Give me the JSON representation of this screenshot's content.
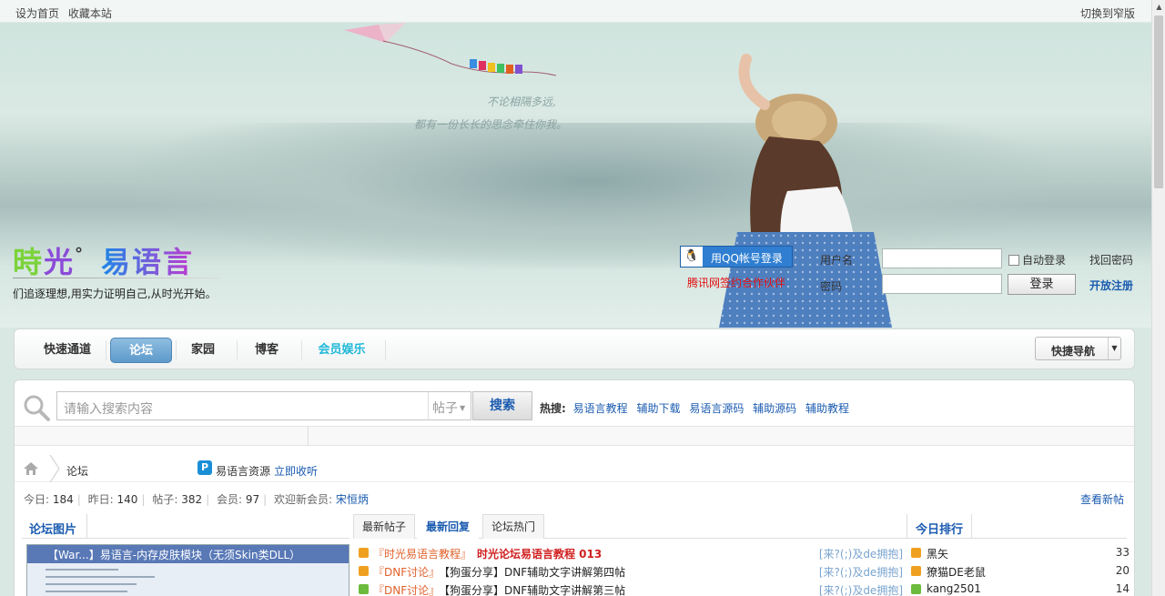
{
  "topbar": {
    "set_home": "设为首页",
    "bookmark": "收藏本站",
    "switch_width": "切换到窄版"
  },
  "header": {
    "logo_parts": [
      "時",
      "光",
      "°",
      "易语言"
    ],
    "slogan": "们追逐理想,用实力证明自己,从时光开始。",
    "poem_line1": "不论相隔多远,",
    "poem_line2": "都有一份长长的思念牵住你我。"
  },
  "login": {
    "qq_button": "用QQ帐号登录",
    "qq_partner": "腾讯网签约合作伙伴",
    "username_label": "用户名",
    "password_label": "密码",
    "auto_login": "自动登录",
    "forgot": "找回密码",
    "login_button": "登录",
    "register": "开放注册"
  },
  "nav": {
    "items": [
      "快速通道",
      "论坛",
      "家园",
      "博客",
      "会员娱乐"
    ],
    "active_index": 1,
    "quick_nav": "快捷导航"
  },
  "search": {
    "placeholder": "请输入搜索内容",
    "type": "帖子",
    "button": "搜索",
    "hot_label": "热搜:",
    "hot": [
      "易语言教程",
      "辅助下载",
      "易语言源码",
      "辅助源码",
      "辅助教程"
    ]
  },
  "breadcrumb": {
    "forum": "论坛",
    "resource": "易语言资源",
    "collect": "立即收听"
  },
  "stats": {
    "today_label": "今日:",
    "today": "184",
    "yesterday_label": "昨日:",
    "yesterday": "140",
    "posts_label": "帖子:",
    "posts": "382",
    "members_label": "会员:",
    "members": "97",
    "welcome_label": "欢迎新会员:",
    "new_member": "宋恒炳",
    "view_new": "查看新帖"
  },
  "panes": {
    "pics_title": "论坛图片",
    "pic_caption": "【War...】易语言-内存皮肤模块（无须Skin类DLL）",
    "tabs": [
      "最新帖子",
      "最新回复",
      "论坛热门"
    ],
    "selected_tab": 1,
    "rank_title": "今日排行"
  },
  "posts": [
    {
      "cat": "『时光易语言教程』",
      "title": "时光论坛易语言教程 013",
      "hot": true,
      "user": "[来?(;)及de拥抱]",
      "color": "#f0a020"
    },
    {
      "cat": "『DNF讨论』",
      "title": "【狗蛋分享】DNF辅助文字讲解第四帖",
      "hot": false,
      "user": "[来?(;)及de拥抱]",
      "color": "#f0a020"
    },
    {
      "cat": "『DNF讨论』",
      "title": "【狗蛋分享】DNF辅助文字讲解第三帖",
      "hot": false,
      "user": "[来?(;)及de拥抱]",
      "color": "#6cbb3c"
    }
  ],
  "ranking": [
    {
      "name": "黑矢",
      "count": "33",
      "color": "#f0a020"
    },
    {
      "name": "獠猫DE老鼠",
      "count": "20",
      "color": "#f0a020"
    },
    {
      "name": "kang2501",
      "count": "14",
      "color": "#6cbb3c"
    }
  ],
  "colors": {
    "accent": "#1a5bb0",
    "nav_active": "#5d9acb",
    "hot_title": "#d02020",
    "category": "#e0602a"
  }
}
